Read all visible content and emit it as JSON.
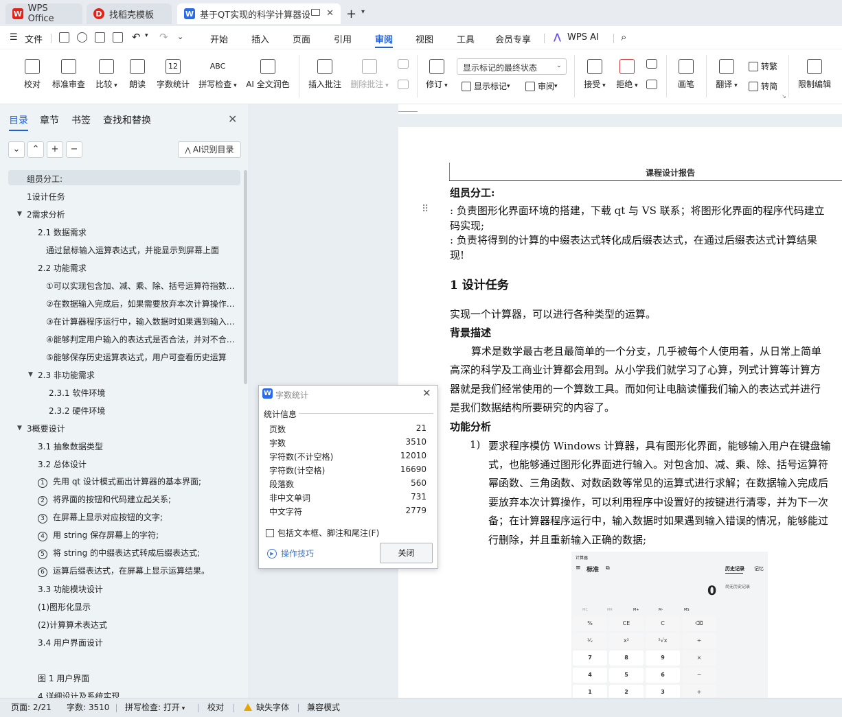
{
  "tabs": [
    {
      "label": "WPS Office"
    },
    {
      "label": "找稻壳模板"
    },
    {
      "label": "基于QT实现的科学计算器设计"
    }
  ],
  "menubar": {
    "file": "文件",
    "items": [
      "开始",
      "插入",
      "页面",
      "引用",
      "审阅",
      "视图",
      "工具",
      "会员专享"
    ],
    "wps_ai": "WPS AI"
  },
  "ribbon": {
    "proofread": "校对",
    "standard_review": "标准审查",
    "compare": "比较",
    "read_aloud": "朗读",
    "word_count": "字数统计",
    "spell_check": "拼写检查",
    "ai_polish": "AI 全文润色",
    "insert_comment": "插入批注",
    "delete_comment": "删除批注",
    "track_changes": "修订",
    "display_select": "显示标记的最终状态",
    "show_markup": "显示标记",
    "review_pane": "审阅",
    "accept": "接受",
    "reject": "拒绝",
    "ink": "画笔",
    "translate": "翻译",
    "to_traditional": "转繁",
    "to_simplified": "转简",
    "restrict_edit": "限制编辑",
    "spell_icon_text": "ABC",
    "wordcount_icon_text": "12"
  },
  "nav": {
    "tabs": [
      "目录",
      "章节",
      "书签",
      "查找和替换"
    ],
    "ai_button": "AI识别目录",
    "toc": [
      "组员分工:",
      "1设计任务",
      "2需求分析",
      "2.1  数据需求",
      "通过鼠标输入运算表达式，并能显示到屏幕上面",
      "2.2  功能需求",
      "①可以实现包含加、减、乘、除、括号运算符指数函数、三角函数",
      "②在数据输入完成后，如果需要放弃本次计算操作，可以利用程序",
      "③在计算器程序运行中，输入数据时如果遇到输入错误的情况",
      "④能够判定用户输入的表达式是否合法，并对不合法的表达式",
      "⑤能够保存历史运算表达式，用户可查看历史运算",
      "2.3  非功能需求",
      "2.3.1 软件环境",
      "2.3.2 硬件环境",
      "3概要设计",
      "3.1 抽象数据类型",
      "3.2  总体设计",
      "先用 qt 设计模式画出计算器的基本界面;",
      "将界面的按钮和代码建立起关系;",
      "在屏幕上显示对应按钮的文字;",
      "用 string 保存屏幕上的字符;",
      "将 string 的中缀表达式转成后缀表达式;",
      "运算后缀表达式，在屏幕上显示运算结果。",
      "3.3  功能模块设计",
      "(1)图形化显示",
      "(2)计算算术表达式",
      "3.4  用户界面设计",
      "图 1  用户界面",
      "4  详细设计及系统实现"
    ],
    "circled": [
      "1",
      "2",
      "3",
      "4",
      "5",
      "6"
    ]
  },
  "document": {
    "header": "课程设计报告",
    "group_title": "组员分工:",
    "line1": ": 负责图形化界面环境的搭建，下载 qt 与 VS 联系；将图形化界面的程序代码建立",
    "line2": "码实现;",
    "line3": ": 负责将得到的计算的中缀表达式转化成后缀表达式，在通过后缀表达式计算结果",
    "line4": "现!",
    "h1": "1   设计任务",
    "p1": "实现一个计算器，可以进行各种类型的运算。",
    "bg_title": "背景描述",
    "bg1": "算术是数学最古老且最简单的一个分支，几乎被每个人使用着，从日常上简单",
    "bg2": "高深的科学及工商业计算都会用到。从小学我们就学习了心算，列式计算等计算方",
    "bg3": "器就是我们经常使用的一个算数工具。而如何让电脑读懂我们输入的表达式并进行",
    "bg4": "是我们数据结构所要研究的内容了。",
    "func_title": "功能分析",
    "item_num": "1)",
    "f1": "要求程序模仿 Windows 计算器，具有图形化界面，能够输入用户在键盘输",
    "f2": "式，也能够通过图形化界面进行输入。对包含加、减、乘、除、括号运算符",
    "f3": "幂函数、三角函数、对数函数等常见的运算式进行求解；在数据输入完成后",
    "f4": "要放弃本次计算操作，可以利用程序中设置好的按键进行清零，并为下一次",
    "f5": "备；在计算器程序运行中，输入数据时如果遇到输入错误的情况，能够能过",
    "f6": "行删除，并且重新输入正确的数据;"
  },
  "calculator": {
    "app": "计算器",
    "mode": "标准",
    "history": "历史记录",
    "memory": "记忆",
    "display": "0",
    "no_history": "尚无历史记录",
    "mem_keys": [
      "MC",
      "MR",
      "M+",
      "M-",
      "MS"
    ],
    "keys": [
      "%",
      "CE",
      "C",
      "⌫",
      "¹⁄ₓ",
      "x²",
      "²√x",
      "÷",
      "7",
      "8",
      "9",
      "×",
      "4",
      "5",
      "6",
      "−",
      "1",
      "2",
      "3",
      "+"
    ]
  },
  "word_count_dialog": {
    "title": "字数统计",
    "section": "统计信息",
    "stats": [
      {
        "label": "页数",
        "value": "21"
      },
      {
        "label": "字数",
        "value": "3510"
      },
      {
        "label": "字符数(不计空格)",
        "value": "12010"
      },
      {
        "label": "字符数(计空格)",
        "value": "16690"
      },
      {
        "label": "段落数",
        "value": "560"
      },
      {
        "label": "非中文单词",
        "value": "731"
      },
      {
        "label": "中文字符",
        "value": "2779"
      }
    ],
    "include_label": "包括文本框、脚注和尾注(F)",
    "tips": "操作技巧",
    "close": "关闭"
  },
  "statusbar": {
    "page": "页面: 2/21",
    "words": "字数: 3510",
    "spell": "拼写检查: 打开",
    "proof": "校对",
    "missing_font": "缺失字体",
    "compat": "兼容模式"
  }
}
